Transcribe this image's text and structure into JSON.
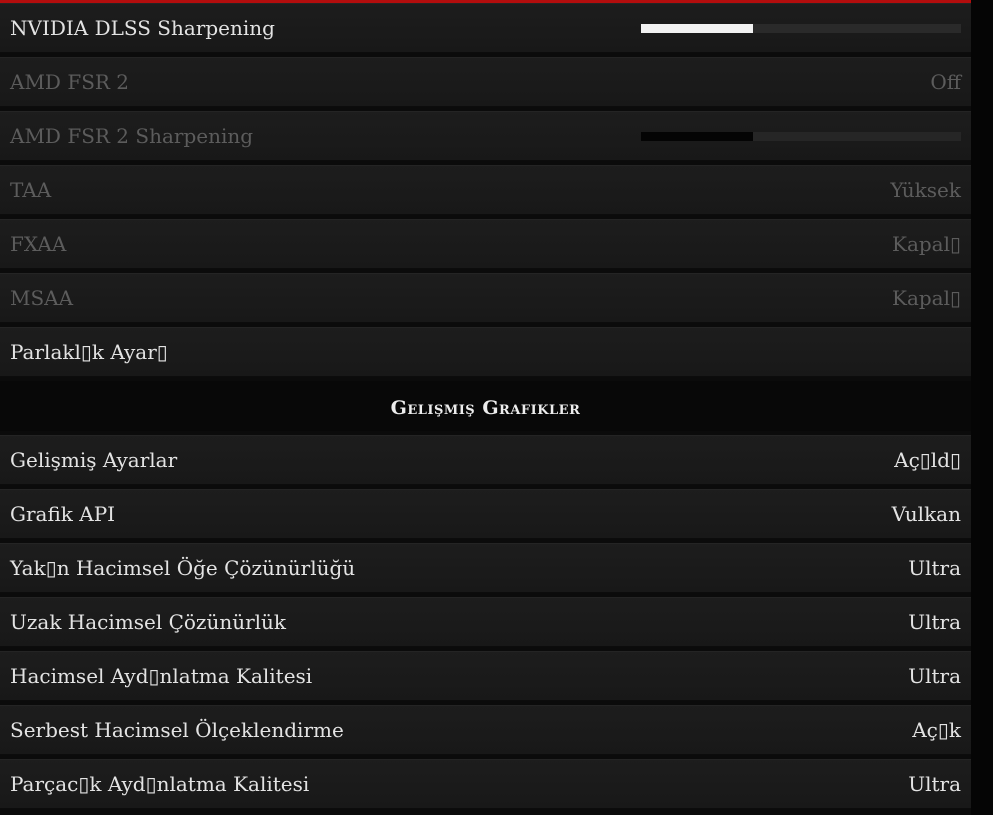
{
  "colors": {
    "accent_bar": "#b30d0d",
    "row_bg": "#1a1a1a",
    "text_enabled": "#e3e3e3",
    "text_disabled": "#5c5c5c"
  },
  "rows_top": [
    {
      "label": "NVIDIA DLSS Sharpening",
      "type": "slider",
      "level": 0.35,
      "disabled": false
    },
    {
      "label": "AMD FSR 2",
      "value": "Off",
      "type": "value",
      "disabled": true
    },
    {
      "label": "AMD FSR 2 Sharpening",
      "type": "slider",
      "level": 0.35,
      "disabled": true
    },
    {
      "label": "TAA",
      "value": "Yüksek",
      "type": "value",
      "disabled": true
    },
    {
      "label": "FXAA",
      "value": "Kapal▯",
      "type": "value",
      "disabled": true
    },
    {
      "label": "MSAA",
      "value": "Kapal▯",
      "type": "value",
      "disabled": true
    },
    {
      "label": "Parlakl▯k Ayar▯",
      "type": "none",
      "disabled": false
    }
  ],
  "section": {
    "title": "Gelişmiş Grafikler"
  },
  "rows_advanced": [
    {
      "label": "Gelişmiş Ayarlar",
      "value": "Aç▯ld▯"
    },
    {
      "label": "Grafik API",
      "value": "Vulkan"
    },
    {
      "label": "Yak▯n Hacimsel Öğe Çözünürlüğü",
      "value": "Ultra"
    },
    {
      "label": "Uzak Hacimsel Çözünürlük",
      "value": "Ultra"
    },
    {
      "label": "Hacimsel Ayd▯nlatma Kalitesi",
      "value": "Ultra"
    },
    {
      "label": "Serbest Hacimsel Ölçeklendirme",
      "value": "Aç▯k"
    },
    {
      "label": "Parçac▯k Ayd▯nlatma Kalitesi",
      "value": "Ultra"
    }
  ]
}
